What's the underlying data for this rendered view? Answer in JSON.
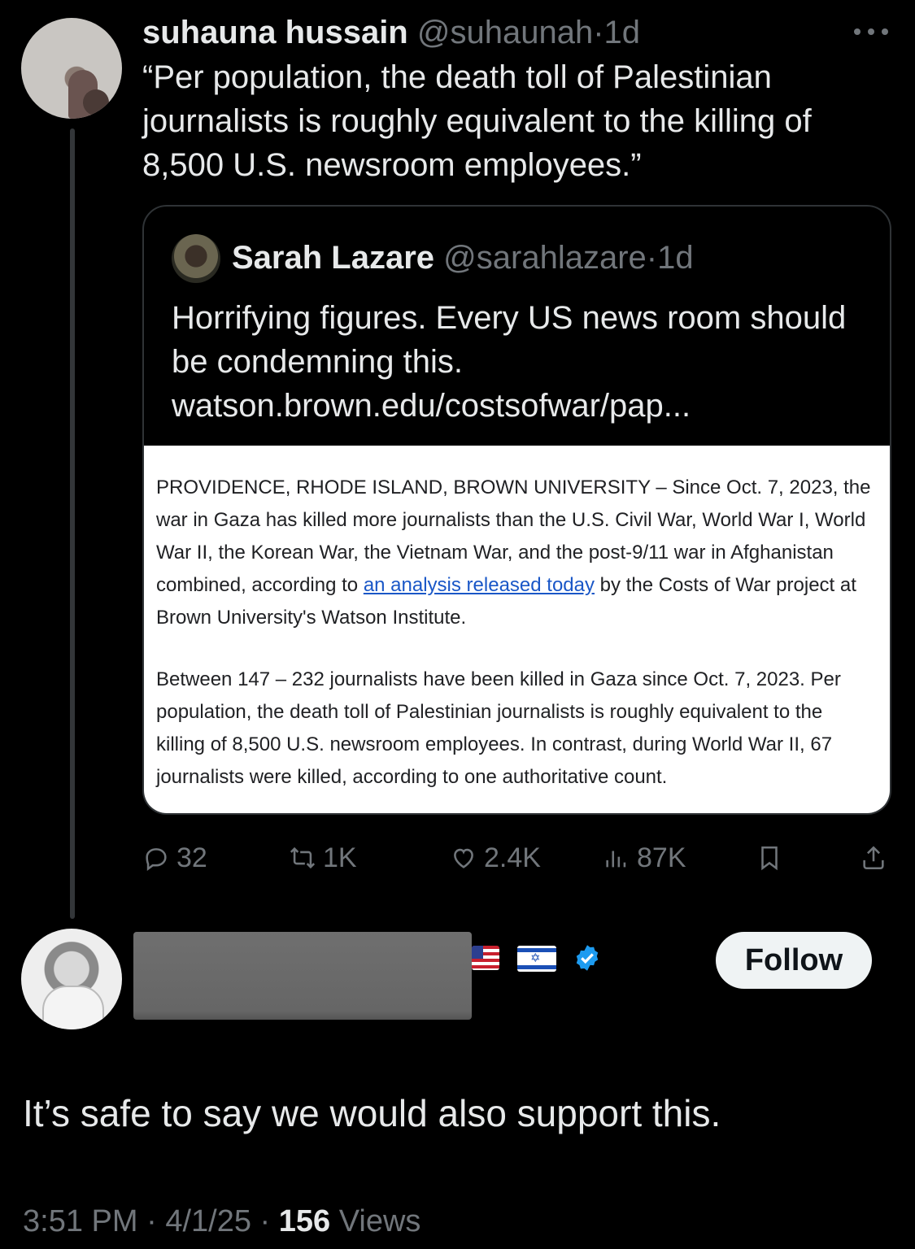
{
  "parent_tweet": {
    "display_name": "suhauna hussain",
    "handle": "@suhaunah",
    "separator": "·",
    "age": "1d",
    "more_icon": "more-horizontal-icon",
    "text": "“Per population, the death toll of Palestinian journalists is roughly equivalent to the killing of 8,500 U.S. newsroom employees.”"
  },
  "quoted_tweet": {
    "display_name": "Sarah Lazare",
    "handle": "@sarahlazare",
    "separator": "·",
    "age": "1d",
    "text": "Horrifying figures. Every US news room should be condemning this.",
    "link": "watson.brown.edu/costsofwar/pap...",
    "image": {
      "p1_before": "PROVIDENCE, RHODE ISLAND, BROWN UNIVERSITY – Since Oct. 7, 2023, the war in Gaza has killed more journalists than the U.S. Civil War, World War I, World War II, the Korean War, the Vietnam War, and the post-9/11 war in Afghanistan combined, according to ",
      "p1_link": "an analysis released today",
      "p1_after": " by the Costs of War project at Brown University's Watson Institute.",
      "p2": "Between 147 – 232 journalists have been killed in Gaza since Oct. 7, 2023. Per population, the death toll of Palestinian journalists is roughly equivalent to the killing of 8,500 U.S. newsroom employees. In contrast, during World War II, 67 journalists were killed, according to one authoritative count."
    }
  },
  "actions": {
    "replies": "32",
    "retweets": "1K",
    "likes": "2.4K",
    "views": "87K",
    "icons": [
      "reply-icon",
      "retweet-icon",
      "like-icon",
      "views-icon",
      "bookmark-icon",
      "share-icon"
    ]
  },
  "reply_tweet": {
    "flags": [
      "us-flag-icon",
      "israel-flag-icon"
    ],
    "verified": "verified-badge-icon",
    "follow_label": "Follow",
    "text": "It’s safe to say we would also support this.",
    "time": "3:51 PM",
    "date": "4/1/25",
    "separator": "·",
    "views_count": "156",
    "views_label": "Views"
  },
  "colors": {
    "background": "#000000",
    "text": "#e7e9ea",
    "muted": "#71767b",
    "border": "#2f3336",
    "verified": "#1d9bf0",
    "link": "#1a57c7"
  }
}
